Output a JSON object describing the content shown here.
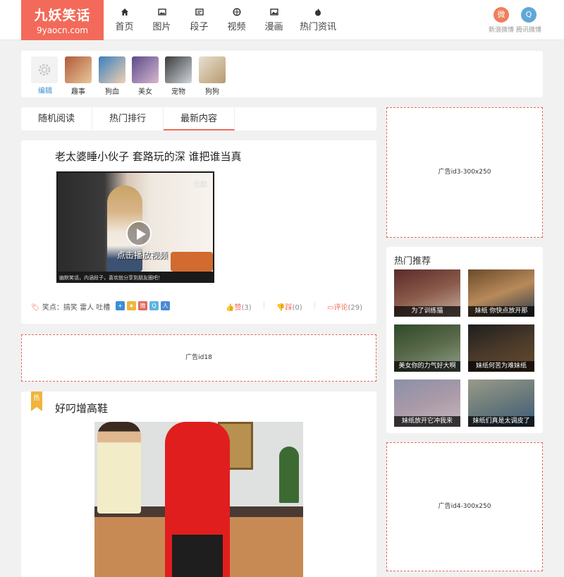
{
  "header": {
    "logo_cn": "九妖笑话",
    "logo_en": "9yaocn.com",
    "nav": [
      {
        "label": "首页",
        "icon": "home-icon"
      },
      {
        "label": "图片",
        "icon": "image-icon"
      },
      {
        "label": "段子",
        "icon": "text-icon"
      },
      {
        "label": "视频",
        "icon": "video-icon"
      },
      {
        "label": "漫画",
        "icon": "comic-icon"
      },
      {
        "label": "热门资讯",
        "icon": "flame-icon"
      }
    ],
    "social": [
      {
        "label": "新浪微博",
        "icon": "weibo-icon",
        "glyph": "微",
        "color": "#ef7f5c"
      },
      {
        "label": "腾讯微博",
        "icon": "tencent-weibo-icon",
        "glyph": "Q",
        "color": "#5fa8d6"
      }
    ]
  },
  "categories": {
    "edit_label": "编辑",
    "items": [
      {
        "label": "趣事",
        "color": "#b05a3a"
      },
      {
        "label": "狗血",
        "color": "#3a7fbf"
      },
      {
        "label": "美女",
        "color": "#5a4a8a"
      },
      {
        "label": "宠物",
        "color": "#7a8a9a"
      },
      {
        "label": "狗狗",
        "color": "#c9b8a0"
      }
    ]
  },
  "tabs": [
    "随机阅读",
    "热门排行",
    "最新内容"
  ],
  "active_tab": "最新内容",
  "post1": {
    "title": "老太婆睡小伙子 套路玩的深 谁把谁当真",
    "video_cta": "点击播放视频",
    "video_watermark": "优酷",
    "video_caption": "幽默笑话，内涵段子，喜欢就分享到朋友圈吧！",
    "tag_label": "笑点：",
    "tags": "搞笑  雷人  吐槽",
    "likes_label": "赞",
    "likes": "(3)",
    "dislikes_label": "踩",
    "dislikes": "(0)",
    "comments_label": "评论",
    "comments": "(29)"
  },
  "ads": {
    "ad18": "广告id18",
    "ad3": "广告id3-300x250",
    "ad4": "广告id4-300x250"
  },
  "post2": {
    "badge": "热",
    "title": "好叼增高鞋"
  },
  "hot": {
    "title": "热门推荐",
    "items": [
      {
        "caption": "为了训练猫",
        "c1": "#5a2a2a",
        "c2": "#c8b0a0"
      },
      {
        "caption": "妹纸 你快点放开那",
        "c1": "#6a4a2a",
        "c2": "#2a3a4a"
      },
      {
        "caption": "美女你的力气好大啊",
        "c1": "#2f4a2a",
        "c2": "#8fa08a"
      },
      {
        "caption": "妹纸何苦为难妹纸",
        "c1": "#1e1e1e",
        "c2": "#6a4a2a"
      },
      {
        "caption": "妹纸放开它冲我来",
        "c1": "#8a90a8",
        "c2": "#c8b8c0"
      },
      {
        "caption": "妹纸们真是太调皮了",
        "c1": "#9a9a8a",
        "c2": "#3a5a7a"
      }
    ]
  }
}
